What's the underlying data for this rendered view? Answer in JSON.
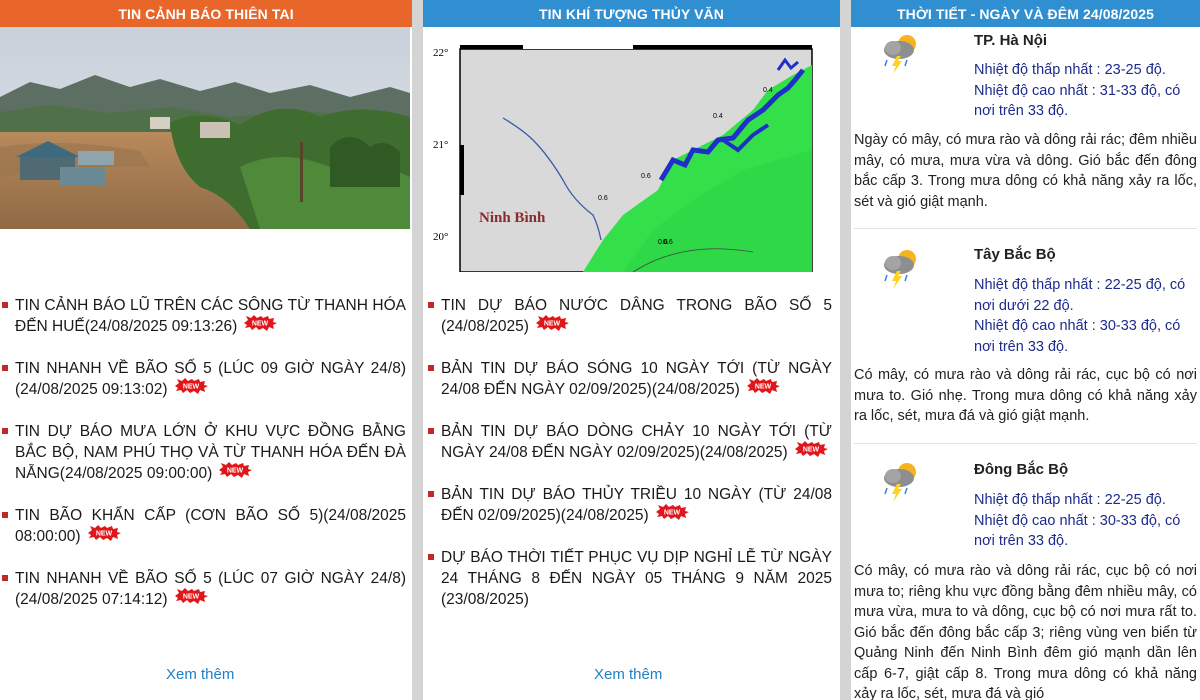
{
  "panel1": {
    "title": "TIN CẢNH BÁO THIÊN TAI",
    "news": [
      {
        "text": "TIN CẢNH BÁO LŨ TRÊN CÁC SÔNG TỪ THANH HÓA ĐẾN HUẾ",
        "date": "(24/08/2025 09:13:26)"
      },
      {
        "text": "TIN NHANH VỀ BÃO SỐ 5 (LÚC 09 GIỜ NGÀY 24/8)",
        "date": "(24/08/2025 09:13:02)"
      },
      {
        "text": "TIN DỰ BÁO MƯA LỚN Ở KHU VỰC ĐỒNG BẰNG BẮC BỘ, NAM PHÚ THỌ VÀ TỪ THANH HÓA ĐẾN ĐÀ NẴNG",
        "date": "(24/08/2025 09:00:00)"
      },
      {
        "text": "TIN BÃO KHẨN CẤP (CƠN BÃO SỐ 5)",
        "date": "(24/08/2025 08:00:00)"
      },
      {
        "text": "TIN NHANH VỀ BÃO SỐ 5 (LÚC 07 GIỜ NGÀY 24/8)",
        "date": "(24/08/2025 07:14:12)"
      }
    ],
    "more": "Xem thêm"
  },
  "panel2": {
    "title": "TIN KHÍ TƯỢNG THỦY VĂN",
    "map": {
      "place_label": "Ninh Bình",
      "lat_labels": [
        "22°",
        "21°",
        "20°"
      ],
      "contour_labels": [
        "0.4",
        "0.6",
        "0.6",
        "0.4",
        "0.6",
        "0.6"
      ]
    },
    "news": [
      {
        "text": "TIN DỰ BÁO NƯỚC DÂNG TRONG BÃO SỐ 5",
        "date": "(24/08/2025)",
        "badge": true
      },
      {
        "text": "BẢN TIN DỰ BÁO SÓNG 10 NGÀY TỚI (TỪ NGÀY 24/08 ĐẾN NGÀY 02/09/2025)",
        "date": "(24/08/2025)",
        "badge": true
      },
      {
        "text": "BẢN TIN DỰ BÁO DÒNG CHẢY 10 NGÀY TỚI (TỪ NGÀY 24/08 ĐẾN NGÀY 02/09/2025)",
        "date": "(24/08/2025)",
        "badge": true
      },
      {
        "text": "BẢN TIN DỰ BÁO THỦY TRIỀU 10 NGÀY (TỪ 24/08 ĐẾN 02/09/2025)",
        "date": "(24/08/2025)",
        "badge": true
      },
      {
        "text": "DỰ BÁO THỜI TIẾT PHỤC VỤ DỊP NGHỈ LỄ TỪ NGÀY 24 THÁNG 8 ĐẾN NGÀY 05 THÁNG 9 NĂM 2025",
        "date": "(23/08/2025)",
        "badge": false
      }
    ],
    "more": "Xem thêm"
  },
  "panel3": {
    "title": "THỜI TIẾT - NGÀY VÀ ĐÊM 24/08/2025",
    "regions": [
      {
        "name": "TP. Hà Nội",
        "min": "Nhiệt độ thấp nhất : 23-25 độ.",
        "max": "Nhiệt độ cao nhất : 31-33 độ, có nơi trên 33 độ.",
        "desc": "Ngày có mây, có mưa rào và dông rải rác; đêm nhiều mây, có mưa, mưa vừa và dông. Gió bắc đến đông bắc cấp 3. Trong mưa dông có khả năng xảy ra lốc, sét và gió giật mạnh."
      },
      {
        "name": "Tây Bắc Bộ",
        "min": "Nhiệt độ thấp nhất : 22-25 độ, có nơi dưới 22 độ.",
        "max": "Nhiệt độ cao nhất : 30-33 độ, có nơi trên 33 độ.",
        "desc": "Có mây, có mưa rào và dông rải rác, cục bộ có nơi mưa to. Gió nhẹ. Trong mưa dông có khả năng xảy ra lốc, sét, mưa đá và gió giật mạnh."
      },
      {
        "name": "Đông Bắc Bộ",
        "min": "Nhiệt độ thấp nhất : 22-25 độ.",
        "max": "Nhiệt độ cao nhất : 30-33 độ, có nơi trên 33 độ.",
        "desc": "Có mây, có mưa rào và dông rải rác, cục bộ có nơi mưa to; riêng khu vực đồng bằng đêm nhiều mây, có mưa vừa, mưa to và dông, cục bộ có nơi mưa rất to. Gió bắc đến đông bắc cấp 3; riêng vùng ven biển từ Quảng Ninh đến Ninh Bình đêm gió mạnh dần lên cấp 6-7, giật cấp 8. Trong mưa dông có khả năng xảy ra lốc, sét, mưa đá và gió"
      }
    ]
  },
  "colors": {
    "orange_header": "#e8662a",
    "blue_header": "#2f8fd0",
    "bullet": "#c0282c",
    "link": "#1f7fc4",
    "temperature_text": "#1c2b8c"
  }
}
